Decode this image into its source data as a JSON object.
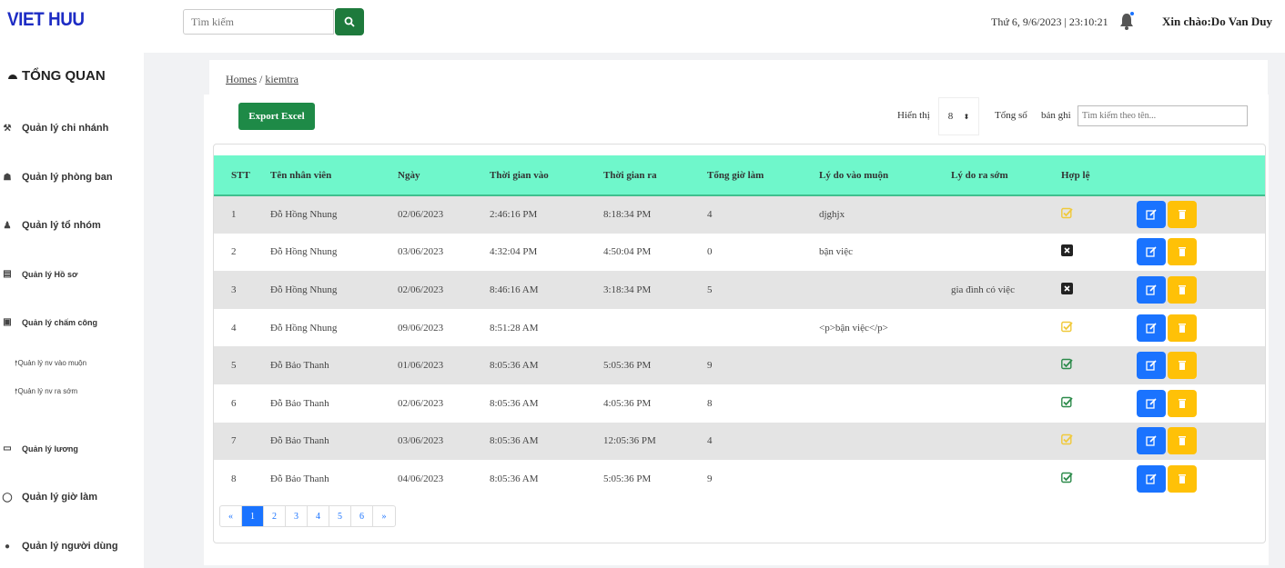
{
  "header": {
    "logo": "VIET HUU",
    "search_placeholder": "Tìm kiếm",
    "datetime": "Thứ 6, 9/6/2023 | 23:10:21",
    "greeting": "Xin chào:Do Van Duy"
  },
  "sidebar": {
    "title": "TỔNG QUAN",
    "items": [
      {
        "label": "Quản lý chi nhánh"
      },
      {
        "label": "Quản lý phòng ban"
      },
      {
        "label": "Quản lý tổ nhóm"
      },
      {
        "label": "Quản lý Hồ sơ"
      },
      {
        "label": "Quản lý chấm công"
      },
      {
        "label": "Quản lý lương"
      },
      {
        "label": "Quản lý giờ làm"
      },
      {
        "label": "Quản lý người dùng"
      }
    ],
    "subitems": [
      "Quản lý nv vào muộn",
      "Quản lý nv ra sớm"
    ]
  },
  "breadcrumb": {
    "home": "Homes",
    "current": "kiemtra"
  },
  "toolbar": {
    "export_label": "Export Excel",
    "show_label": "Hiển thị",
    "show_value": "8",
    "total_label": "Tổng số",
    "record_label": "bản ghi",
    "search_placeholder": "Tìm kiếm theo tên..."
  },
  "table": {
    "headers": [
      "STT",
      "Tên nhân viên",
      "Ngày",
      "Thời gian vào",
      "Thời gian ra",
      "Tổng giờ làm",
      "Lý do vào muộn",
      "Lý do ra sớm",
      "Hợp lệ"
    ],
    "rows": [
      {
        "stt": "1",
        "name": "Đỗ Hồng Nhung",
        "date": "02/06/2023",
        "in": "2:46:16 PM",
        "out": "8:18:34 PM",
        "hours": "4",
        "late": "djghjx",
        "early": "",
        "valid": "pending"
      },
      {
        "stt": "2",
        "name": "Đỗ Hồng Nhung",
        "date": "03/06/2023",
        "in": "4:32:04 PM",
        "out": "4:50:04 PM",
        "hours": "0",
        "late": "bận việc",
        "early": "",
        "valid": "invalid"
      },
      {
        "stt": "3",
        "name": "Đỗ Hồng Nhung",
        "date": "02/06/2023",
        "in": "8:46:16 AM",
        "out": "3:18:34 PM",
        "hours": "5",
        "late": "",
        "early": "gia đình có việc",
        "valid": "invalid"
      },
      {
        "stt": "4",
        "name": "Đỗ Hồng Nhung",
        "date": "09/06/2023",
        "in": "8:51:28 AM",
        "out": "",
        "hours": "",
        "late": "<p>bận việc</p>",
        "early": "",
        "valid": "pending"
      },
      {
        "stt": "5",
        "name": "Đỗ Bảo Thanh",
        "date": "01/06/2023",
        "in": "8:05:36 AM",
        "out": "5:05:36 PM",
        "hours": "9",
        "late": "",
        "early": "",
        "valid": "valid"
      },
      {
        "stt": "6",
        "name": "Đỗ Bảo Thanh",
        "date": "02/06/2023",
        "in": "8:05:36 AM",
        "out": "4:05:36 PM",
        "hours": "8",
        "late": "",
        "early": "",
        "valid": "valid"
      },
      {
        "stt": "7",
        "name": "Đỗ Bảo Thanh",
        "date": "03/06/2023",
        "in": "8:05:36 AM",
        "out": "12:05:36 PM",
        "hours": "4",
        "late": "",
        "early": "",
        "valid": "pending"
      },
      {
        "stt": "8",
        "name": "Đỗ Bảo Thanh",
        "date": "04/06/2023",
        "in": "8:05:36 AM",
        "out": "5:05:36 PM",
        "hours": "9",
        "late": "",
        "early": "",
        "valid": "valid"
      }
    ]
  },
  "pagination": {
    "prev": "«",
    "pages": [
      "1",
      "2",
      "3",
      "4",
      "5",
      "6"
    ],
    "next": "»",
    "active": "1"
  },
  "colors": {
    "accent_green": "#1e7a3c",
    "header_mint": "#6ff7cb",
    "edit_blue": "#1a73ff",
    "delete_yellow": "#ffc107",
    "logo_blue": "#1d2cc4"
  }
}
